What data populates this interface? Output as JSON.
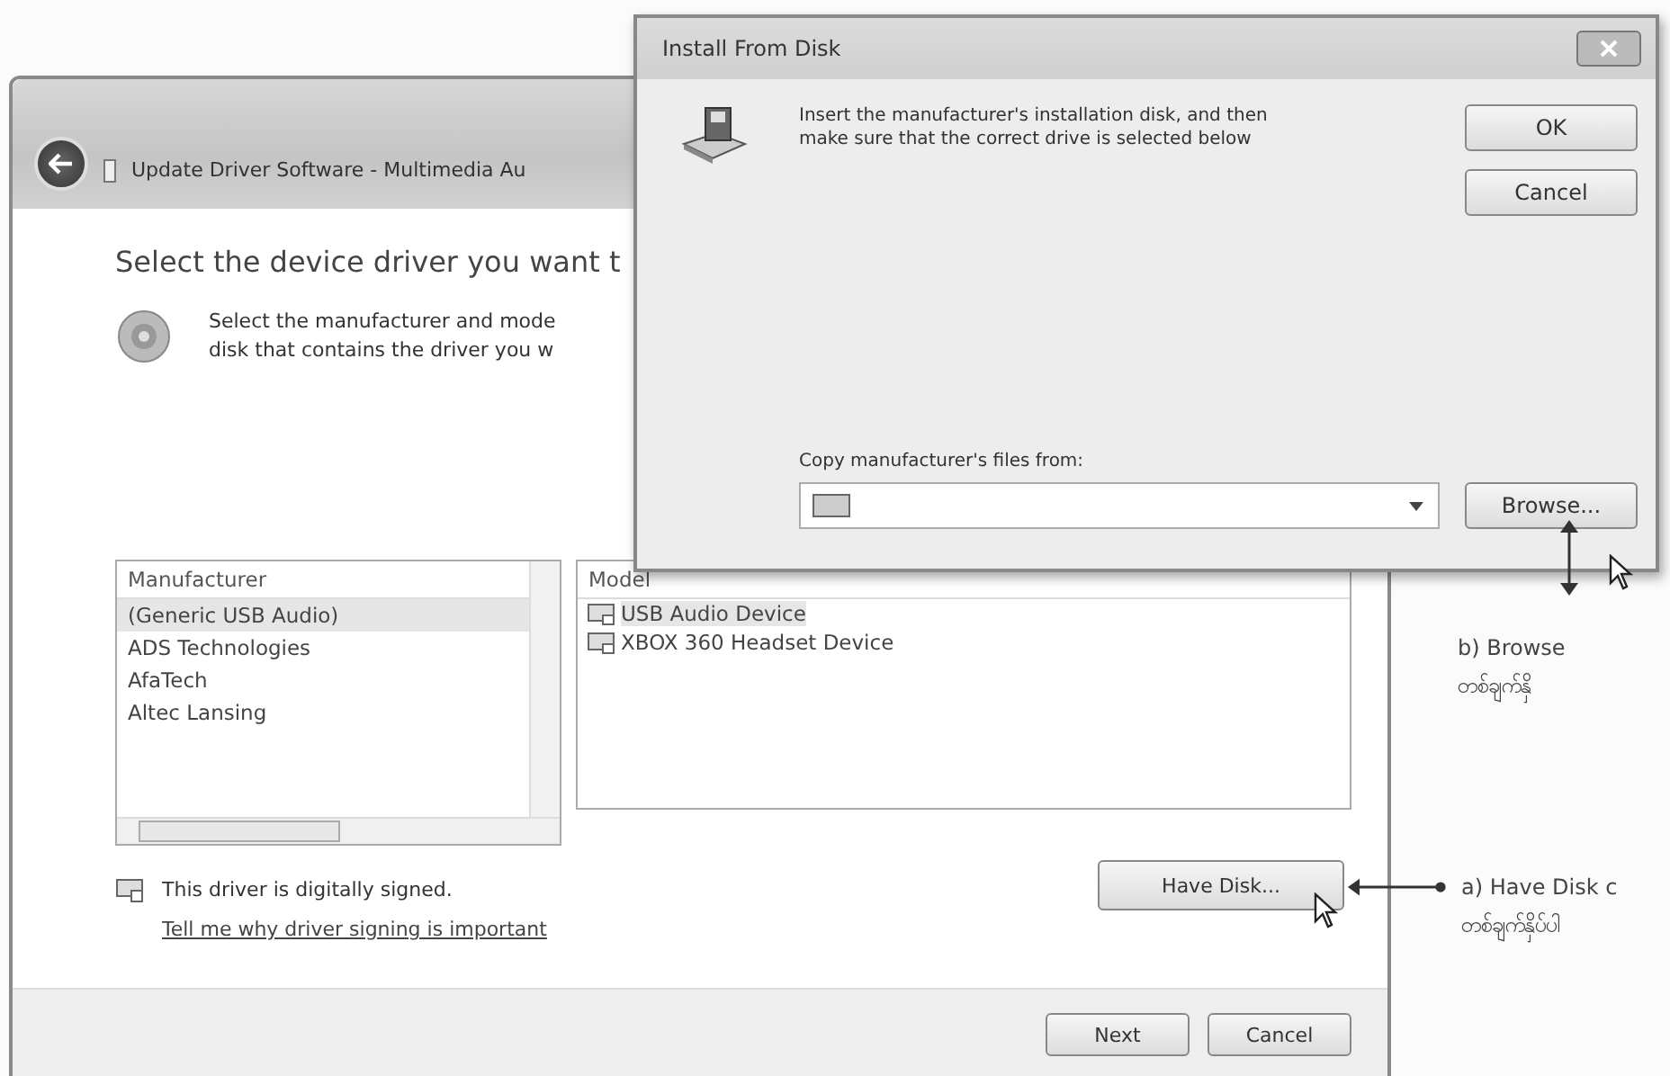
{
  "main_window": {
    "title": "Update Driver Software - Multimedia Au",
    "heading": "Select the device driver you want t",
    "instruction_lines": [
      "Select the manufacturer and mode",
      "disk that contains the driver you w"
    ],
    "manufacturer_list": {
      "header": "Manufacturer",
      "items": [
        {
          "label": "(Generic USB Audio)",
          "selected": true
        },
        {
          "label": "ADS Technologies",
          "selected": false
        },
        {
          "label": "AfaTech",
          "selected": false
        },
        {
          "label": "Altec Lansing",
          "selected": false
        }
      ]
    },
    "model_list": {
      "header": "Model",
      "items": [
        {
          "label": "USB Audio Device",
          "selected": true
        },
        {
          "label": "XBOX 360 Headset Device",
          "selected": false
        }
      ]
    },
    "signed_text": "This driver is digitally signed.",
    "signing_link": "Tell me why driver signing is important",
    "have_disk_button": "Have Disk...",
    "buttons": [
      "Next",
      "Cancel"
    ]
  },
  "dialog": {
    "title": "Install From Disk",
    "message_lines": [
      "Insert the manufacturer's installation disk, and then",
      "make sure that the correct drive is selected below"
    ],
    "buttons": [
      "OK",
      "Cancel"
    ],
    "copy_label": "Copy manufacturer's files from:",
    "browse_button": "Browse..."
  },
  "annotations": [
    {
      "kind": "browse",
      "lines": [
        "b) Browse",
        "တစ်ချက်နှိ"
      ]
    },
    {
      "kind": "have_disk",
      "lines": [
        "a) Have Disk c",
        "တစ်ချက်နှိပ်ပါ"
      ]
    }
  ]
}
